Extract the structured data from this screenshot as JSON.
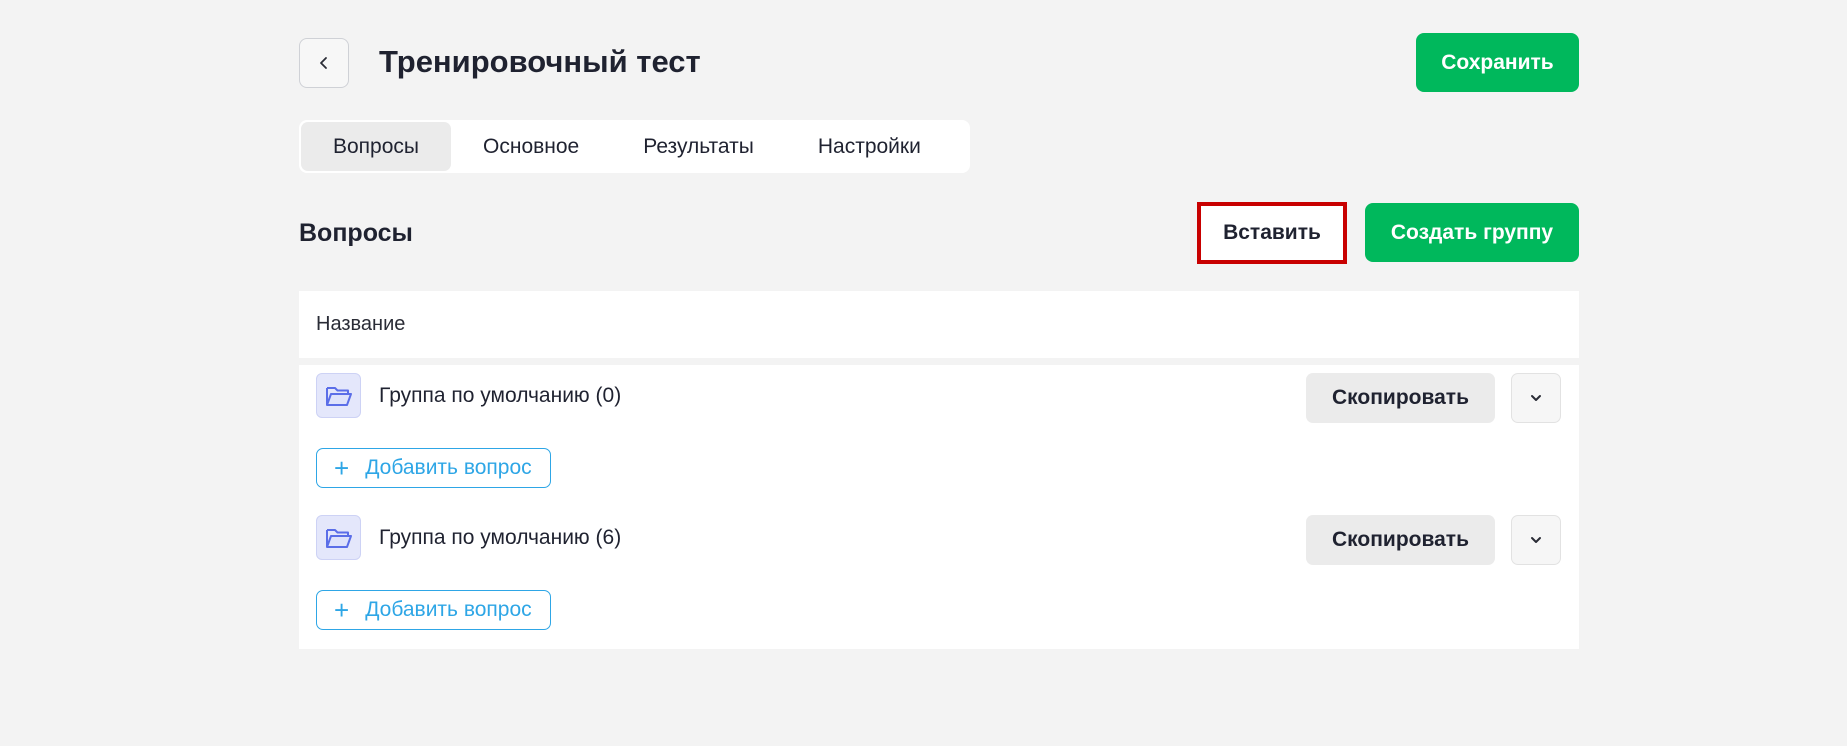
{
  "header": {
    "title": "Тренировочный тест",
    "save_label": "Сохранить",
    "back_icon": "chevron-left-icon"
  },
  "tabs": [
    {
      "label": "Вопросы",
      "active": true
    },
    {
      "label": "Основное",
      "active": false
    },
    {
      "label": "Результаты",
      "active": false
    },
    {
      "label": "Настройки",
      "active": false
    }
  ],
  "section": {
    "title": "Вопросы",
    "paste_label": "Вставить",
    "create_group_label": "Создать группу"
  },
  "table": {
    "column_header": "Название",
    "groups": [
      {
        "name": "Группа по умолчанию (0)",
        "copy_label": "Скопировать",
        "add_question_label": "Добавить вопрос",
        "icon": "folder-open-icon"
      },
      {
        "name": "Группа по умолчанию (6)",
        "copy_label": "Скопировать",
        "add_question_label": "Добавить вопрос",
        "icon": "folder-open-icon"
      }
    ]
  },
  "colors": {
    "background": "#f3f3f3",
    "primary_green": "#00b85c",
    "link_blue": "#2ea6e6",
    "highlight_red": "#c80000",
    "folder_accent": "#5b6ee8"
  }
}
